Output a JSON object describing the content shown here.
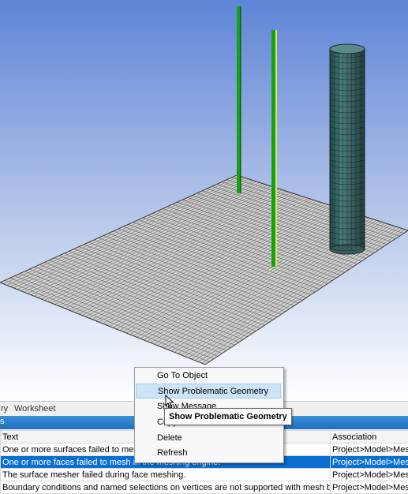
{
  "tabs": [
    {
      "label": "ry"
    },
    {
      "label": "Worksheet"
    }
  ],
  "messages_panel": {
    "header_text": "s",
    "columns": {
      "text": "Text",
      "association": "Association"
    },
    "rows": [
      {
        "text": "One or more surfaces failed to mesh. Re",
        "association": "Project>Model>Mesh"
      },
      {
        "text": "One or more faces failed to mesh in the meshing engine.",
        "association": "Project>Model>Mesh"
      },
      {
        "text": "The surface mesher failed during face meshing.",
        "association": "Project>Model>Mesh"
      },
      {
        "text": "Boundary conditions and named selections on vertices are not supported with mesh based",
        "association": "Project>Model>Mesh"
      }
    ],
    "selected_row": 1
  },
  "context_menu": {
    "items": [
      {
        "label": "Go To Object"
      },
      {
        "label": "Show Problematic Geometry",
        "highlighted": true
      },
      {
        "label": "Show Message"
      },
      {
        "label": "Copy"
      },
      {
        "label": "Delete"
      },
      {
        "label": "Refresh"
      }
    ]
  },
  "tooltip": {
    "text": "Show Problematic Geometry"
  },
  "colors": {
    "viewport_top": "#5e84d6",
    "viewport_bottom": "#ffffff",
    "selection": "#0a6fd0",
    "menu_highlight": "#cde3f7",
    "rod_green": "#16a016",
    "rod_highlight": "#e8e060",
    "mesh_line": "#3a3a3a",
    "cylinder_fill": "#2f6060"
  },
  "icons": [
    "mouse-pointer-icon"
  ]
}
